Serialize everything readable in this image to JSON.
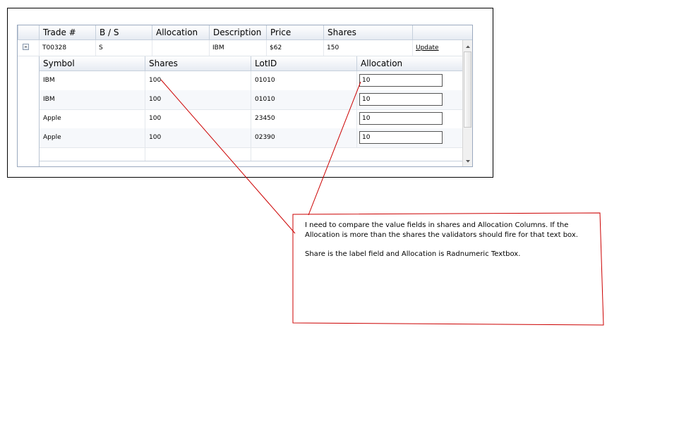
{
  "master": {
    "columns": [
      "Trade #",
      "B / S",
      "Allocation",
      "Description",
      "Price",
      "Shares",
      ""
    ],
    "row": {
      "trade": "T00328",
      "bs": "S",
      "allocation": "",
      "description": "IBM",
      "price": "$62",
      "shares": "150",
      "update_label": "Update"
    }
  },
  "detail": {
    "columns": [
      "Symbol",
      "Shares",
      "LotID",
      "Allocation"
    ],
    "rows": [
      {
        "symbol": "IBM",
        "shares": "100",
        "lotid": "01010",
        "allocation": "10"
      },
      {
        "symbol": "IBM",
        "shares": "100",
        "lotid": "01010",
        "allocation": "10"
      },
      {
        "symbol": "Apple",
        "shares": "100",
        "lotid": "23450",
        "allocation": "10"
      },
      {
        "symbol": "Apple",
        "shares": "100",
        "lotid": "02390",
        "allocation": "10"
      }
    ]
  },
  "note": {
    "line1": "I need to compare the value fields in shares and Allocation Columns. If the Allocation is more than the shares the validators should fire for that text box.",
    "line2": "Share is the label field and Allocation is Radnumeric Textbox."
  },
  "colors": {
    "annotation": "#cc0000",
    "grid_border": "#9aa9bf",
    "header_bg": "#e6ebf2"
  }
}
